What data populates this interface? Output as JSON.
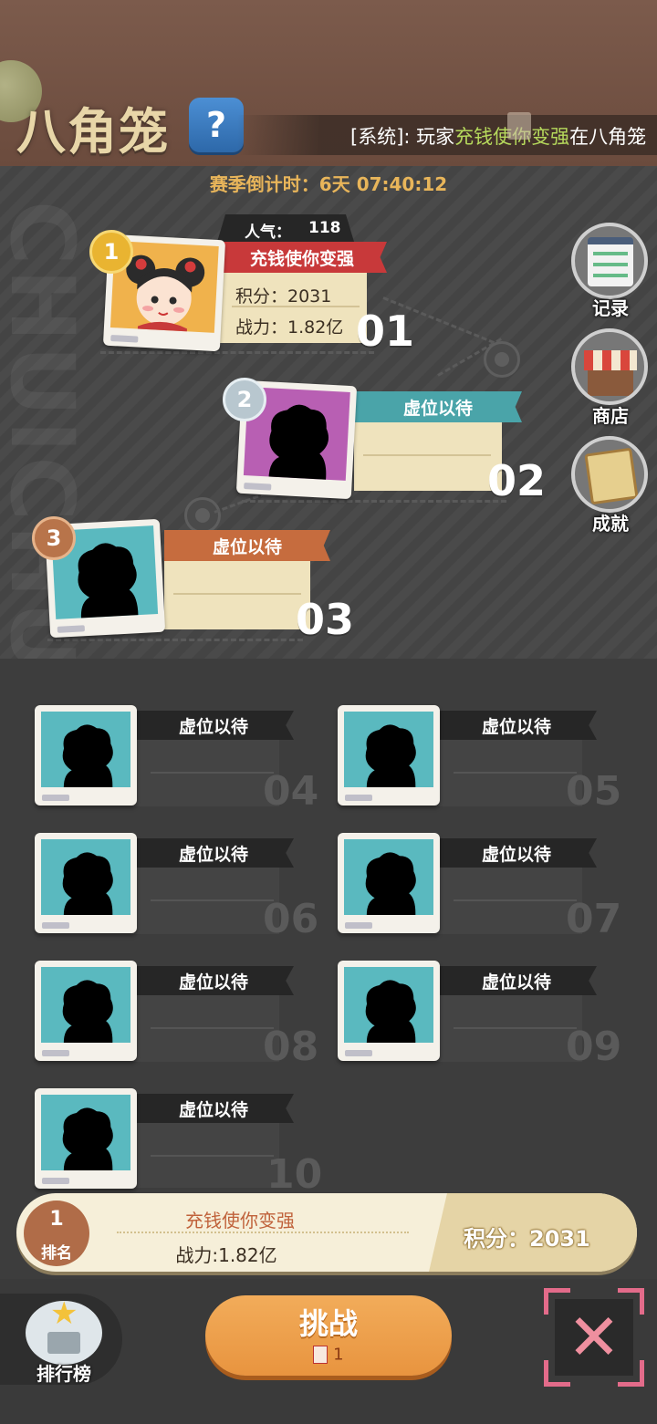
{
  "header": {
    "title": "八角笼",
    "help_label": "?",
    "marquee_prefix": "[系统]: 玩家",
    "marquee_player": "充钱使你变强",
    "marquee_suffix": "在八角笼"
  },
  "season": {
    "countdown": "赛季倒计时：6天 07:40:12"
  },
  "watermark": "CHUICHUI",
  "top3": [
    {
      "rank": "1",
      "rank_number": "01",
      "name": "充钱使你变强",
      "popularity_label": "人气：",
      "popularity": "118",
      "score": "积分：2031",
      "power": "战力：1.82亿"
    },
    {
      "rank": "2",
      "rank_number": "02",
      "name": "虚位以待"
    },
    {
      "rank": "3",
      "rank_number": "03",
      "name": "虚位以待"
    }
  ],
  "side": {
    "records": "记录",
    "shop": "商店",
    "achievements": "成就"
  },
  "slots": [
    {
      "label": "虚位以待",
      "number": "04"
    },
    {
      "label": "虚位以待",
      "number": "05"
    },
    {
      "label": "虚位以待",
      "number": "06"
    },
    {
      "label": "虚位以待",
      "number": "07"
    },
    {
      "label": "虚位以待",
      "number": "08"
    },
    {
      "label": "虚位以待",
      "number": "09"
    },
    {
      "label": "虚位以待",
      "number": "10"
    }
  ],
  "me": {
    "rank": "1",
    "rank_label": "排名",
    "name": "充钱使你变强",
    "power": "战力:1.82亿",
    "score": "积分：2031"
  },
  "bottom": {
    "leaderboard": "排行榜",
    "challenge": "挑战",
    "ticket_count": "1"
  },
  "colors": {
    "gold_medal": "#e9b431",
    "silver_medal": "#b8c7cf",
    "bronze_medal": "#b8744a",
    "red_ribbon": "#c8393a",
    "teal_ribbon": "#4aa4a9",
    "orange_ribbon": "#c66c3e"
  }
}
